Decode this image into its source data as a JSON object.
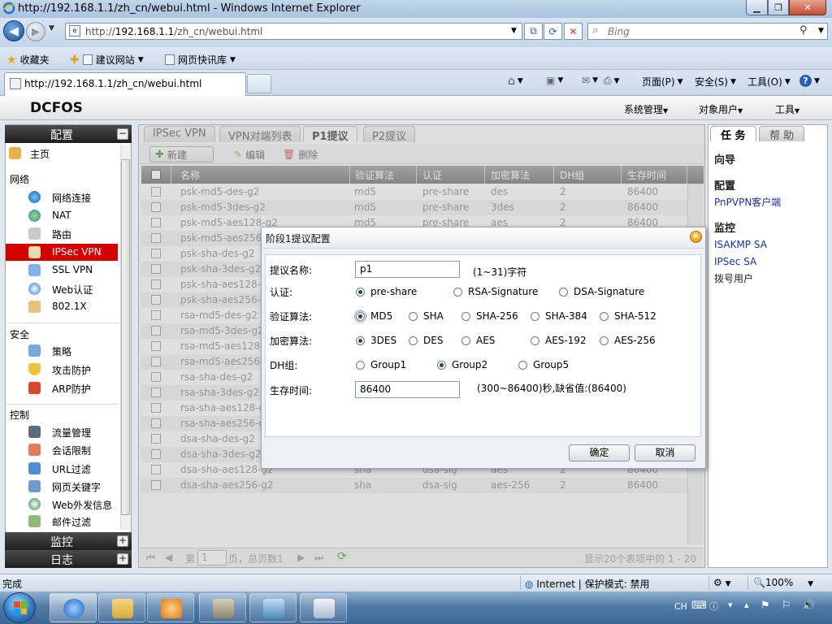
{
  "window": {
    "title": "http://192.168.1.1/zh_cn/webui.html - Windows Internet Explorer",
    "min": "▁",
    "max": "❐",
    "close": "✕"
  },
  "address": {
    "url_prefix": "http://",
    "url_host": "192.168.1.1",
    "url_path": "/zh_cn/webui.html",
    "search_placeholder": "Bing"
  },
  "favbar": {
    "favorites": "收藏夹",
    "suggested": "建议网站",
    "slices": "网页快讯库"
  },
  "tab": {
    "title": "http://192.168.1.1/zh_cn/webui.html"
  },
  "commands": {
    "page": "页面(P)",
    "safety": "安全(S)",
    "tools": "工具(O)"
  },
  "app": {
    "logo": "DCFOS",
    "menu": [
      "系统管理",
      "对象用户",
      "工具"
    ]
  },
  "sidebar": {
    "config_header": "配置",
    "monitor_header": "监控",
    "log_header": "日志",
    "home": "主页",
    "sections": [
      "网络",
      "安全",
      "控制"
    ],
    "network_items": [
      "网络连接",
      "NAT",
      "路由",
      "IPSec VPN",
      "SSL VPN",
      "Web认证",
      "802.1X"
    ],
    "security_items": [
      "策略",
      "攻击防护",
      "ARP防护"
    ],
    "control_items": [
      "流量管理",
      "会话限制",
      "URL过滤",
      "网页关键字",
      "Web外发信息",
      "邮件过滤"
    ]
  },
  "main": {
    "tabs": [
      "IPSec VPN",
      "VPN对端列表",
      "P1提议",
      "P2提议"
    ],
    "toolbar": {
      "new": "新建",
      "edit": "编辑",
      "delete": "删除"
    },
    "columns": [
      "名称",
      "验证算法",
      "认证",
      "加密算法",
      "DH组",
      "生存时间"
    ],
    "rows": [
      [
        "psk-md5-des-g2",
        "md5",
        "pre-share",
        "des",
        "2",
        "86400"
      ],
      [
        "psk-md5-3des-g2",
        "md5",
        "pre-share",
        "3des",
        "2",
        "86400"
      ],
      [
        "psk-md5-aes128-g2",
        "md5",
        "pre-share",
        "aes",
        "2",
        "86400"
      ],
      [
        "psk-md5-aes256-g2",
        "",
        "",
        "",
        "",
        ""
      ],
      [
        "psk-sha-des-g2",
        "",
        "",
        "",
        "",
        ""
      ],
      [
        "psk-sha-3des-g2",
        "",
        "",
        "",
        "",
        ""
      ],
      [
        "psk-sha-aes128-g2",
        "",
        "",
        "",
        "",
        ""
      ],
      [
        "psk-sha-aes256-g2",
        "",
        "",
        "",
        "",
        ""
      ],
      [
        "rsa-md5-des-g2",
        "",
        "",
        "",
        "",
        ""
      ],
      [
        "rsa-md5-3des-g2",
        "",
        "",
        "",
        "",
        ""
      ],
      [
        "rsa-md5-aes128-g2",
        "",
        "",
        "",
        "",
        ""
      ],
      [
        "rsa-md5-aes256-g2",
        "",
        "",
        "",
        "",
        ""
      ],
      [
        "rsa-sha-des-g2",
        "",
        "",
        "",
        "",
        ""
      ],
      [
        "rsa-sha-3des-g2",
        "",
        "",
        "",
        "",
        ""
      ],
      [
        "rsa-sha-aes128-g2",
        "",
        "",
        "",
        "",
        ""
      ],
      [
        "rsa-sha-aes256-g2",
        "",
        "",
        "",
        "",
        ""
      ],
      [
        "dsa-sha-des-g2",
        "",
        "",
        "",
        "",
        ""
      ],
      [
        "dsa-sha-3des-g2",
        "",
        "",
        "",
        "",
        ""
      ],
      [
        "dsa-sha-aes128-g2",
        "sha",
        "dsa-sig",
        "aes",
        "2",
        "86400"
      ],
      [
        "dsa-sha-aes256-g2",
        "sha",
        "dsa-sig",
        "aes-256",
        "2",
        "86400"
      ]
    ],
    "pager": {
      "page_prefix": "第",
      "page_value": "1",
      "page_suffix": "页，总页数1",
      "summary": "显示20个表项中的 1 - 20"
    }
  },
  "rightpanel": {
    "tab_task": "任 务",
    "tab_help": "帮 助",
    "wizard": "向导",
    "config": "配置",
    "config_link": "PnPVPN客户端",
    "monitor": "监控",
    "monitor_links": [
      "ISAKMP SA",
      "IPSec SA",
      "拨号用户"
    ]
  },
  "dialog": {
    "title": "阶段1提议配置",
    "name_label": "提议名称:",
    "name_value": "p1",
    "name_hint": "(1~31)字符",
    "auth_label": "认证:",
    "auth_options": [
      "pre-share",
      "RSA-Signature",
      "DSA-Signature"
    ],
    "hash_label": "验证算法:",
    "hash_options": [
      "MD5",
      "SHA",
      "SHA-256",
      "SHA-384",
      "SHA-512"
    ],
    "enc_label": "加密算法:",
    "enc_options": [
      "3DES",
      "DES",
      "AES",
      "AES-192",
      "AES-256"
    ],
    "dh_label": "DH组:",
    "dh_options": [
      "Group1",
      "Group2",
      "Group5"
    ],
    "life_label": "生存时间:",
    "life_value": "86400",
    "life_hint": "(300~86400)秒,缺省值:(86400)",
    "ok": "确定",
    "cancel": "取消"
  },
  "status": {
    "left": "完成",
    "zone": "Internet | 保护模式: 禁用",
    "zoom": "100%"
  },
  "tray": {
    "lang": "CH"
  }
}
